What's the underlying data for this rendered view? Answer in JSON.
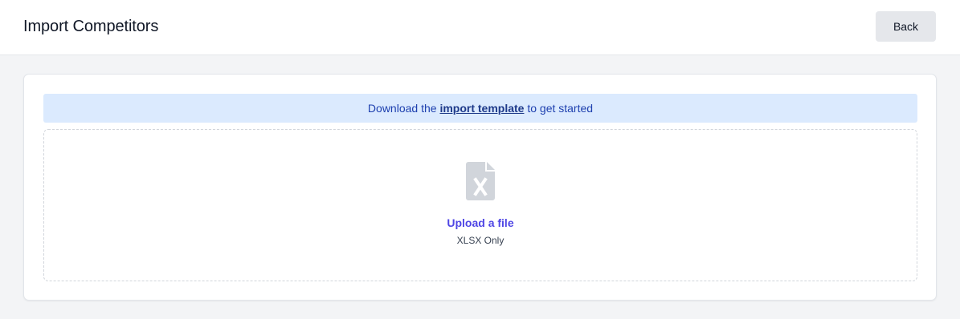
{
  "header": {
    "title": "Import Competitors",
    "back_label": "Back"
  },
  "notice": {
    "prefix": "Download the",
    "link_text": "import template",
    "suffix": "to get started"
  },
  "upload": {
    "icon": "xlsx-file-icon",
    "link_text": "Upload a file",
    "hint": "XLSX Only"
  },
  "colors": {
    "notice_bg": "#dbeafe",
    "notice_text": "#1e40af",
    "upload_link": "#4f46e5",
    "icon_gray": "#d1d5db"
  }
}
